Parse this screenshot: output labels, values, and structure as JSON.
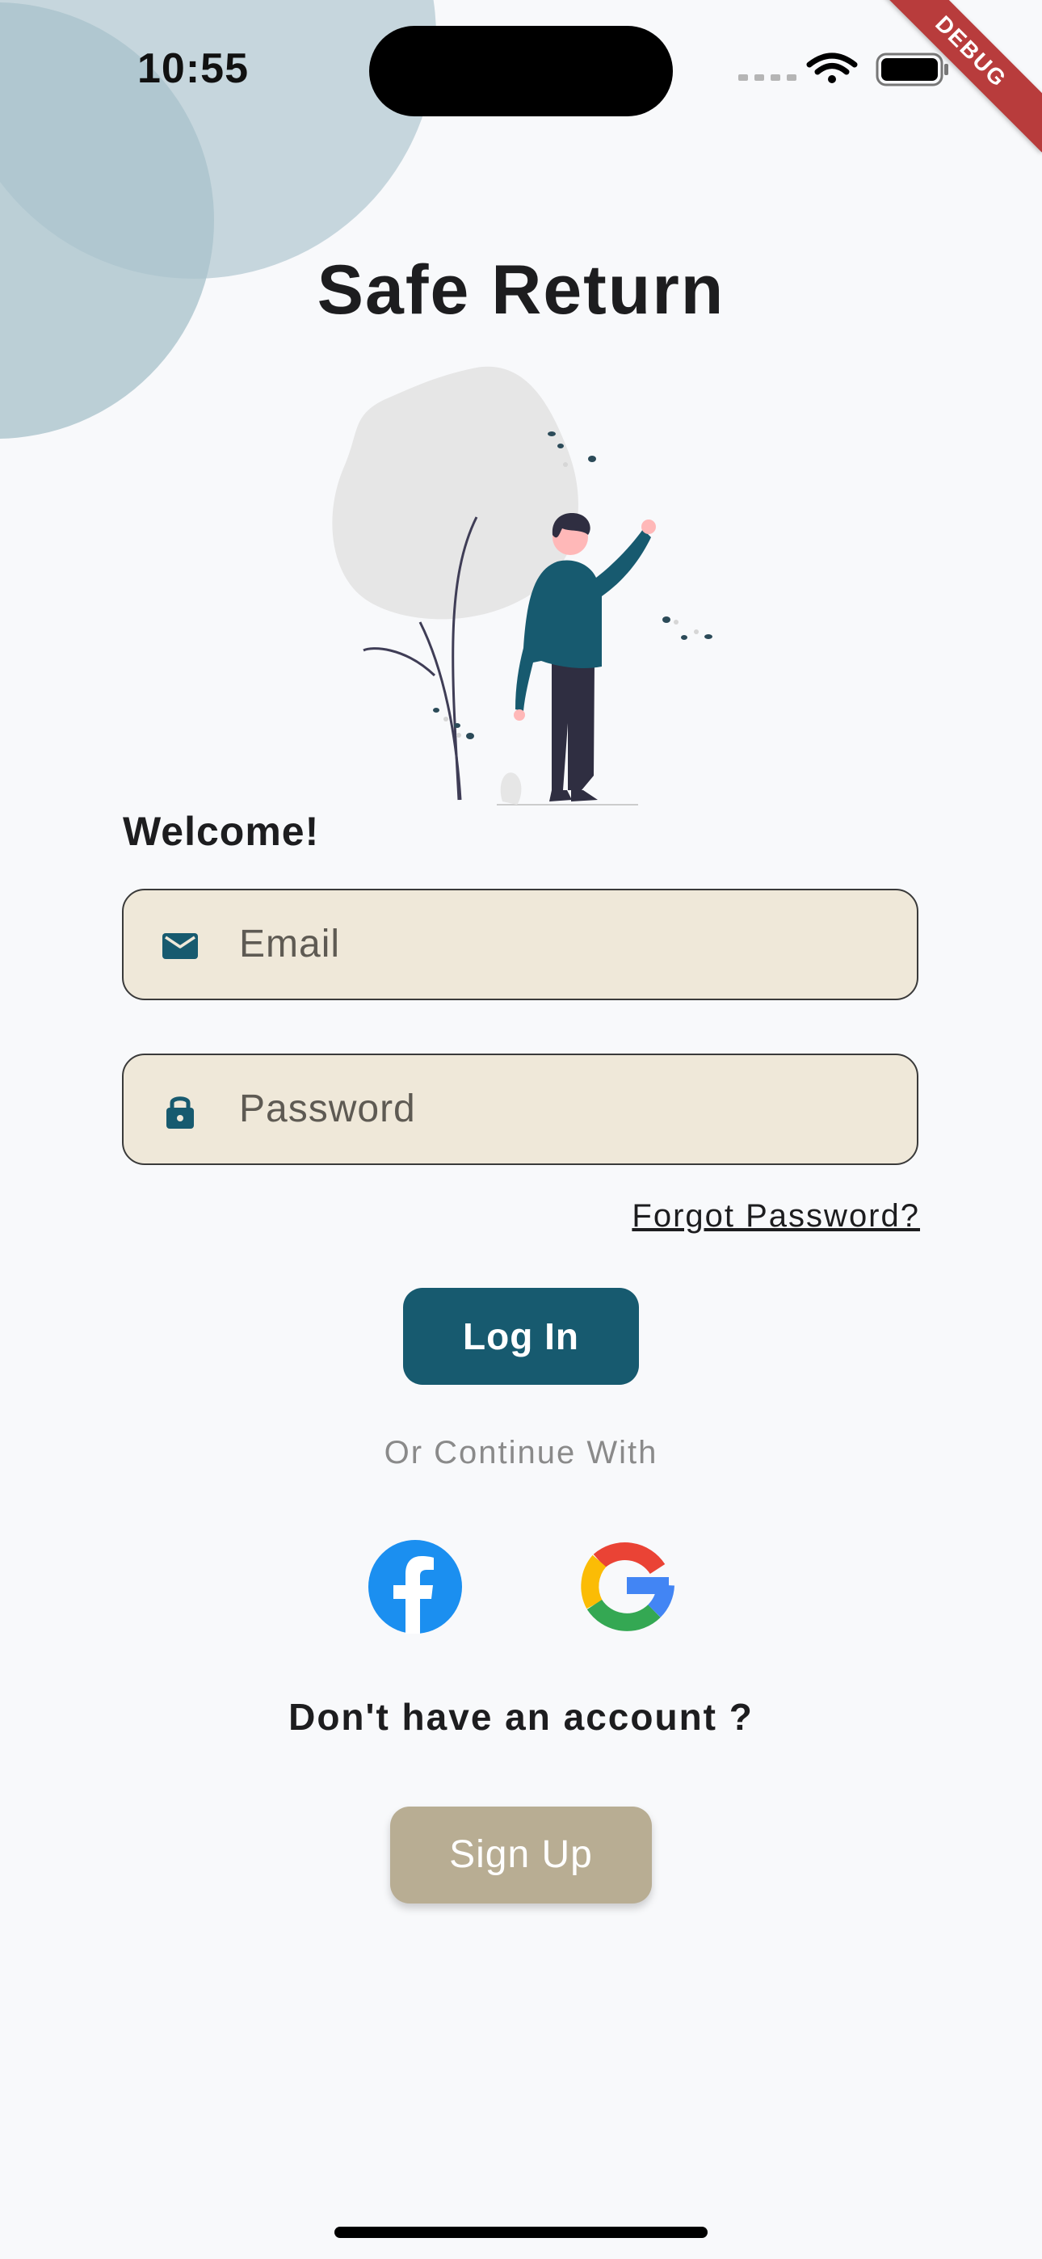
{
  "status_bar": {
    "time": "10:55",
    "icons": [
      "cellular-signal-icon",
      "wifi-icon",
      "battery-icon"
    ]
  },
  "debug_banner": {
    "label": "DEBUG"
  },
  "app": {
    "title": "Safe Return"
  },
  "illustration": {
    "icon": "person-waving-illustration"
  },
  "login_form": {
    "welcome": "Welcome!",
    "email": {
      "placeholder": "Email",
      "icon": "mail-icon"
    },
    "password": {
      "placeholder": "Password",
      "icon": "lock-icon"
    },
    "forgot_password": "Forgot Password?",
    "login_button": "Log In"
  },
  "social_login": {
    "label": "Or Continue With",
    "providers": [
      {
        "name": "facebook",
        "icon": "facebook-icon"
      },
      {
        "name": "google",
        "icon": "google-icon"
      }
    ]
  },
  "signup": {
    "prompt": "Don't have an account ?",
    "button": "Sign Up"
  },
  "colors": {
    "background": "#f8f9fb",
    "primary": "#175a6f",
    "field_fill": "#efe8d9",
    "signup_button": "#b8ad93",
    "circle_light": "#c6d6dd",
    "circle_dark": "#a9c3cc",
    "debug_banner": "#b83c3c"
  }
}
